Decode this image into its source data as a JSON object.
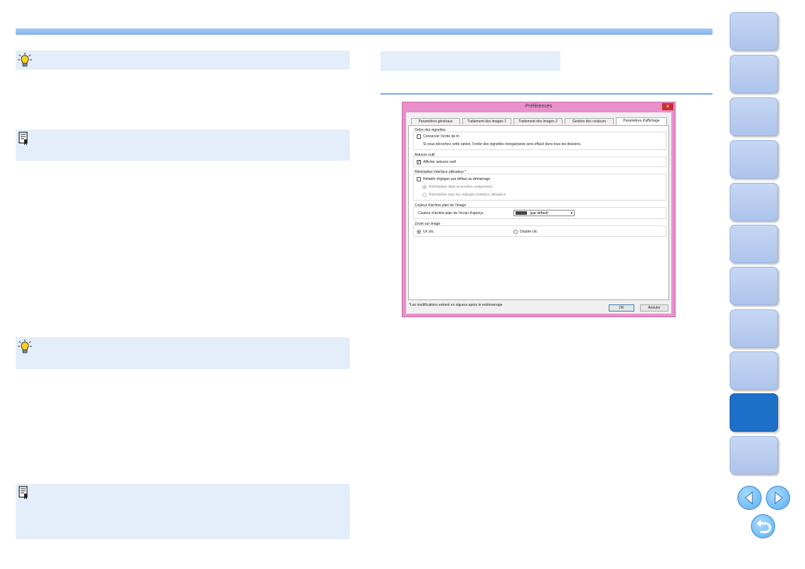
{
  "dialog": {
    "title": "Préférences",
    "close_glyph": "×",
    "tabs": [
      "Paramètres généraux",
      "Traitement des images 1",
      "Traitement des images 2",
      "Gestion des couleurs",
      "Paramètres d'affichage"
    ],
    "active_tab_index": 4,
    "groups": {
      "thumb_order": {
        "title": "Ordre des vignettes",
        "checkbox_label": "Conserver l'ordre de tri",
        "checked": false,
        "hint": "Si vous décochez cette option, l'ordre des vignettes réorganisées sera effacé dans tous les dossiers."
      },
      "tooltips": {
        "title": "Astuces outil",
        "checkbox_label": "Afficher astuces outil",
        "checked": true
      },
      "reset_ui": {
        "title": "Réinitialiser interface utilisateur *",
        "checkbox_label": "Rétablir réglages par défaut au démarrage",
        "checked": false,
        "radio1": "Réinitialiser taille et position uniquement",
        "radio2": "Réinitialiser tous les réglages interface utilisateur"
      },
      "bg_color": {
        "title": "Couleur d'arrière-plan de l'image",
        "label": "Couleur d'arrière-plan de l'écran d'aperçu",
        "select_value": "(par défaut)",
        "swatch_color": "#444444"
      },
      "zoom": {
        "title": "Zoom sur image",
        "radio1": "Un clic",
        "radio2": "Double clic"
      }
    },
    "footer_note": "*Les modifications entrent en vigueur après le redémarrage",
    "ok_label": "OK",
    "cancel_label": "Annuler",
    "chevron_glyph": "▾"
  },
  "colors": {
    "accent": "#7aa8ea",
    "note_bg": "#e4eefb",
    "dialog_frame": "#e990cc",
    "side_active": "#1e6fc8"
  },
  "icons": [
    "tip-bulb-icon",
    "memo-icon",
    "prev-page-icon",
    "next-page-icon",
    "return-icon"
  ],
  "side_nav_count": 11,
  "side_nav_active_index": 9
}
